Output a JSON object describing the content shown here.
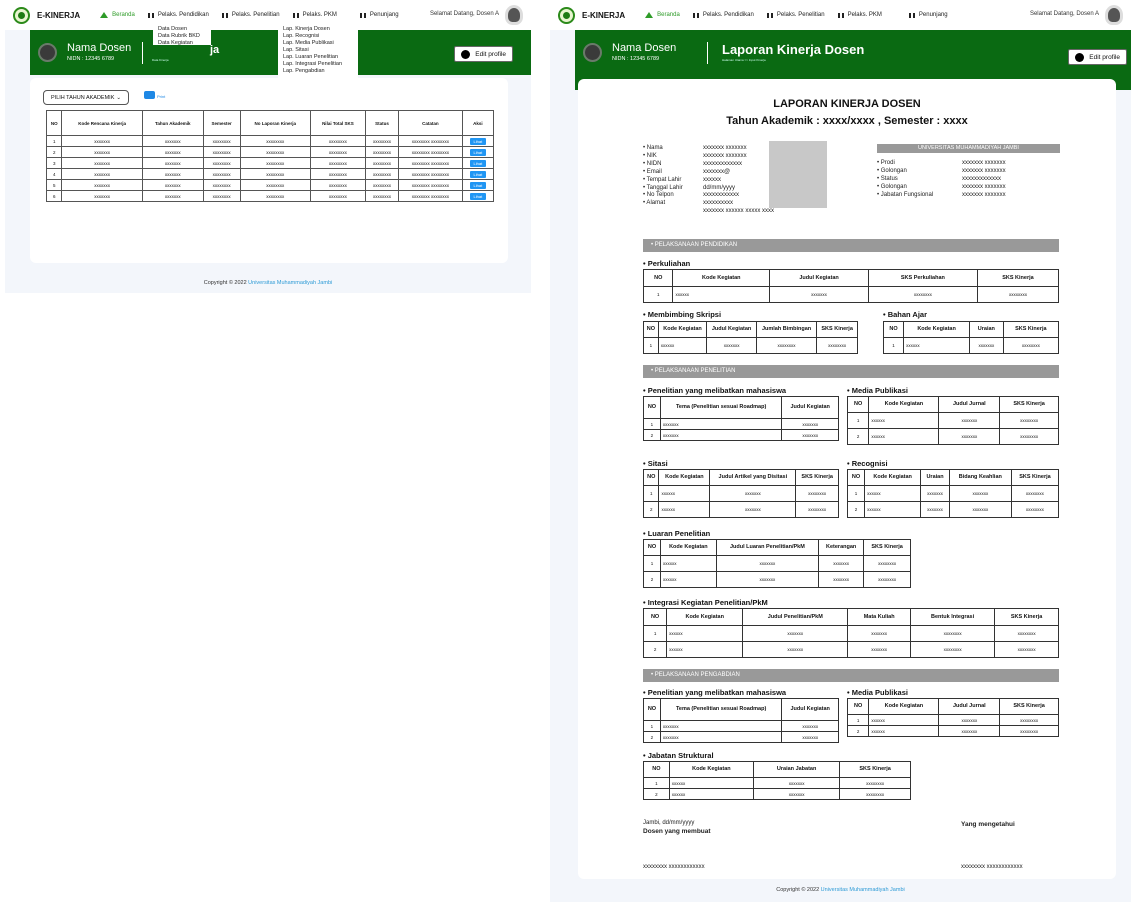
{
  "nav": {
    "brand": "E-KINERJA",
    "items": [
      "Beranda",
      "Pelaks. Pendidikan",
      "Pelaks. Penelitian",
      "Pelaks. PKM",
      "Penunjang"
    ],
    "welcome": "Selamat Datang, Dosen A"
  },
  "user": {
    "name": "Nama Dosen",
    "nidn": "NIDN : 12345 6789"
  },
  "edit_profile": "Edit profile",
  "dropdown_pendidikan": [
    "Data Dosen",
    "Data Rubrik BKD",
    "Data Kegiatan"
  ],
  "dropdown_penelitian": [
    "Lap. Kinerja Dosen",
    "Lap. Recognisi",
    "Lap. Media Publikasi",
    "Lap. Sitasi",
    "Lap. Luaran Penelitian",
    "Lap. Integrasi Penelitian",
    "Lap.  Pengabdian"
  ],
  "left": {
    "title_fragment": "ja",
    "subtitle": "Data Kinerja",
    "select_label": "PILIH TAHUN AKADEMIK",
    "print_label": "Print",
    "headers": [
      "NO",
      "Kode Rencana Kinerja",
      "Tahun Akademik",
      "Semester",
      "No Laporan Kinerja",
      "Nilai Total SKS",
      "Status",
      "Catatan",
      "Aksi"
    ],
    "rows": [
      [
        "1",
        "xxxxxxx",
        "xxxxxxx",
        "xxxxxxxx",
        "xxxxxxxx",
        "xxxxxxxx",
        "xxxxxxxx",
        "xxxxxxxx xxxxxxxx",
        "Lihat"
      ],
      [
        "2",
        "xxxxxxx",
        "xxxxxxx",
        "xxxxxxxx",
        "xxxxxxxx",
        "xxxxxxxx",
        "xxxxxxxx",
        "xxxxxxxx xxxxxxxx",
        "Lihat"
      ],
      [
        "3",
        "xxxxxxx",
        "xxxxxxx",
        "xxxxxxxx",
        "xxxxxxxx",
        "xxxxxxxx",
        "xxxxxxxx",
        "xxxxxxxx xxxxxxxx",
        "Lihat"
      ],
      [
        "4",
        "xxxxxxx",
        "xxxxxxx",
        "xxxxxxxx",
        "xxxxxxxx",
        "xxxxxxxx",
        "xxxxxxxx",
        "xxxxxxxx xxxxxxxx",
        "Lihat"
      ],
      [
        "5",
        "xxxxxxx",
        "xxxxxxx",
        "xxxxxxxx",
        "xxxxxxxx",
        "xxxxxxxx",
        "xxxxxxxx",
        "xxxxxxxx xxxxxxxx",
        "Lihat"
      ],
      [
        "6",
        "xxxxxxx",
        "xxxxxxx",
        "xxxxxxxx",
        "xxxxxxxx",
        "xxxxxxxx",
        "xxxxxxxx",
        "xxxxxxxx xxxxxxxx",
        "Lihat"
      ]
    ]
  },
  "footer": {
    "text": "Copyright © 2022",
    "link": "Universitas Muhammadiyah Jambi"
  },
  "right": {
    "page_title": "Laporan Kinerja Dosen",
    "subtitle": "Halaman Utama >> Input Kinerja",
    "doc_title": "LAPORAN KINERJA DOSEN",
    "doc_sub": "Tahun Akademik : xxxx/xxxx , Semester : xxxx",
    "univ": "UNIVERSITAS MUHAMMADIYAH JAMBI",
    "identity_labels": [
      "• Nama",
      "• NIK",
      "• NIDN",
      "• Email",
      "• Tempat Lahir",
      "• Tanggal Lahir",
      "• No Telpon",
      "• Alamat"
    ],
    "identity_values": [
      "xxxxxxx xxxxxxx",
      "xxxxxxx xxxxxxx",
      "xxxxxxxxxxxxx",
      "xxxxxxx@",
      "xxxxxx",
      "dd/mm/yyyy",
      "xxxxxxxxxxxx",
      "xxxxxxxxxx",
      "xxxxxxx xxxxxx xxxxx xxxx"
    ],
    "univ_labels": [
      "• Prodi",
      "• Golongan",
      "• Status",
      "• Golongan",
      "• Jabatan Fungsional"
    ],
    "univ_values": [
      "xxxxxxx xxxxxxx",
      "xxxxxxx xxxxxxx",
      "xxxxxxxxxxxxx",
      "xxxxxxx xxxxxxx",
      "xxxxxxx xxxxxxx"
    ],
    "sec_pendidikan": "• PELAKSANAAN PENDIDIKAN",
    "sec_penelitian": "• PELAKSANAAN PENELITIAN",
    "sec_pengabdian": "• PELAKSANAAN PENGABDIAN",
    "h_perkuliahan": "• Perkuliahan",
    "h_skripsi": "• Membimbing Skripsi",
    "h_bahan": "• Bahan Ajar",
    "h_pen_mhs": "• Penelitian yang melibatkan mahasiswa",
    "h_media": "• Media Publikasi",
    "h_sitasi": "• Sitasi",
    "h_recog": "• Recognisi",
    "h_luaran": "• Luaran Penelitian",
    "h_integrasi": "• Integrasi Kegiatan Penelitian/PkM",
    "h_pen_mhs2": "• Penelitian yang melibatkan mahasiswa",
    "h_media2": "• Media Publikasi",
    "h_jabatan": "• Jabatan Struktural",
    "t_perkuliahan": {
      "h": [
        "NO",
        "Kode Kegiatan",
        "Judul Kegiatan",
        "SKS Perkuliahan",
        "SKS Kinerja"
      ],
      "r": [
        [
          "1",
          "xxxxxx",
          "xxxxxxx",
          "xxxxxxxx",
          "xxxxxxxx"
        ]
      ]
    },
    "t_skripsi": {
      "h": [
        "NO",
        "Kode Kegiatan",
        "Judul Kegiatan",
        "Jumlah Bimbingan",
        "SKS Kinerja"
      ],
      "r": [
        [
          "1",
          "xxxxxx",
          "xxxxxxx",
          "xxxxxxxx",
          "xxxxxxxx"
        ]
      ]
    },
    "t_bahan": {
      "h": [
        "NO",
        "Kode Kegiatan",
        "Uraian",
        "SKS Kinerja"
      ],
      "r": [
        [
          "1",
          "xxxxxx",
          "xxxxxxx",
          "xxxxxxxx"
        ]
      ]
    },
    "t_pen_mhs": {
      "h": [
        "NO",
        "Tema (Penelitian sesuai Roadmap)",
        "Judul Kegiatan"
      ],
      "r": [
        [
          "1",
          "xxxxxxx",
          "xxxxxxx"
        ],
        [
          "2",
          "xxxxxxx",
          "xxxxxxx"
        ]
      ]
    },
    "t_media": {
      "h": [
        "NO",
        "Kode Kegiatan",
        "Judul Jurnal",
        "SKS Kinerja"
      ],
      "r": [
        [
          "1",
          "xxxxxx",
          "xxxxxxx",
          "xxxxxxxx"
        ],
        [
          "2",
          "xxxxxx",
          "xxxxxxx",
          "xxxxxxxx"
        ]
      ]
    },
    "t_sitasi": {
      "h": [
        "NO",
        "Kode Kegiatan",
        "Judul Artikel yang Disitasi",
        "SKS Kinerja"
      ],
      "r": [
        [
          "1",
          "xxxxxx",
          "xxxxxxx",
          "xxxxxxxx"
        ],
        [
          "2",
          "xxxxxx",
          "xxxxxxx",
          "xxxxxxxx"
        ]
      ]
    },
    "t_recog": {
      "h": [
        "NO",
        "Kode Kegiatan",
        "Uraian",
        "Bidang Keahlian",
        "SKS Kinerja"
      ],
      "r": [
        [
          "1",
          "xxxxxx",
          "xxxxxxx",
          "xxxxxxx",
          "xxxxxxxx"
        ],
        [
          "2",
          "xxxxxx",
          "xxxxxxx",
          "xxxxxxx",
          "xxxxxxxx"
        ]
      ]
    },
    "t_luaran": {
      "h": [
        "NO",
        "Kode Kegiatan",
        "Judul Luaran Penelitian/PkM",
        "Keterangan",
        "SKS Kinerja"
      ],
      "r": [
        [
          "1",
          "xxxxxx",
          "xxxxxxx",
          "xxxxxxx",
          "xxxxxxxx"
        ],
        [
          "2",
          "xxxxxx",
          "xxxxxxx",
          "xxxxxxx",
          "xxxxxxxx"
        ]
      ]
    },
    "t_integrasi": {
      "h": [
        "NO",
        "Kode Kegiatan",
        "Judul Penelitian/PkM",
        "Mata Kuliah",
        "Bentuk Integrasi",
        "SKS Kinerja"
      ],
      "r": [
        [
          "1",
          "xxxxxx",
          "xxxxxxx",
          "xxxxxxx",
          "xxxxxxxx",
          "xxxxxxxx"
        ],
        [
          "2",
          "xxxxxx",
          "xxxxxxx",
          "xxxxxxx",
          "xxxxxxxx",
          "xxxxxxxx"
        ]
      ]
    },
    "t_pen_mhs2": {
      "h": [
        "NO",
        "Tema (Penelitian sesuai Roadmap)",
        "Judul Kegiatan"
      ],
      "r": [
        [
          "1",
          "xxxxxxx",
          "xxxxxxx"
        ],
        [
          "2",
          "xxxxxxx",
          "xxxxxxx"
        ]
      ]
    },
    "t_media2": {
      "h": [
        "NO",
        "Kode Kegiatan",
        "Judul Jurnal",
        "SKS Kinerja"
      ],
      "r": [
        [
          "1",
          "xxxxxx",
          "xxxxxxx",
          "xxxxxxxx"
        ],
        [
          "2",
          "xxxxxx",
          "xxxxxxx",
          "xxxxxxxx"
        ]
      ]
    },
    "t_jabatan": {
      "h": [
        "NO",
        "Kode Kegiatan",
        "Uraian Jabatan",
        "SKS Kinerja"
      ],
      "r": [
        [
          "1",
          "xxxxxx",
          "xxxxxxx",
          "xxxxxxxx"
        ],
        [
          "2",
          "xxxxxx",
          "xxxxxxx",
          "xxxxxxxx"
        ]
      ]
    },
    "sign_place": "Jambi, dd/mm/yyyy",
    "sign_maker": "Dosen yang membuat",
    "sign_know": "Yang mengetahui",
    "sign_name1": "xxxxxxxx xxxxxxxxxxxx",
    "sign_name2": "xxxxxxxx xxxxxxxxxxxx"
  }
}
